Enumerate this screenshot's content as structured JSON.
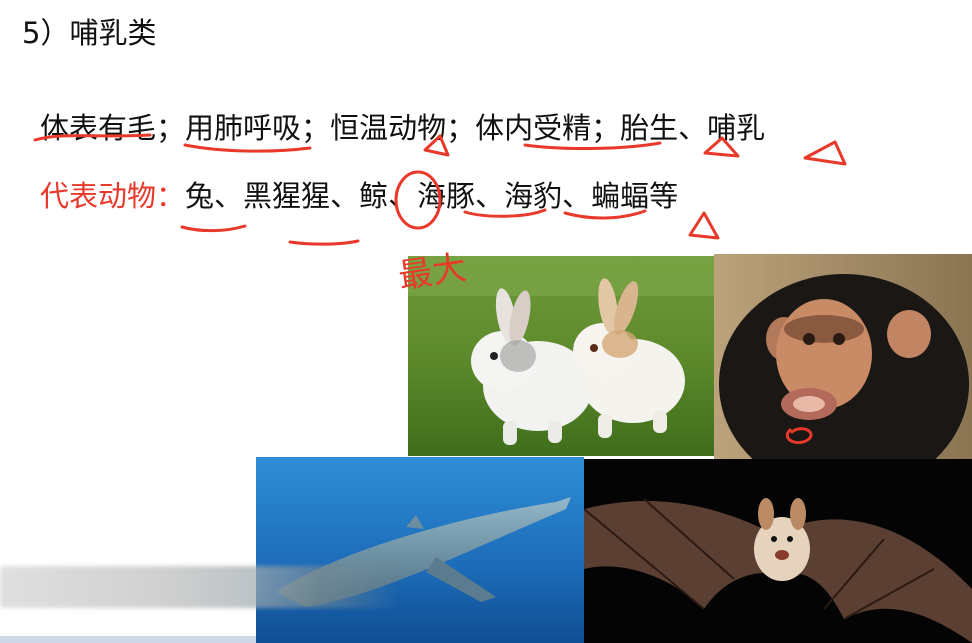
{
  "heading": "5）哺乳类",
  "traits": {
    "t1": "体表有毛",
    "s1": "；",
    "t2": "用肺呼吸",
    "s2": "；",
    "t3": "恒温动物",
    "s3": "；",
    "t4": "体内受精",
    "s4": "；",
    "t5": "胎生",
    "s5": "、",
    "t6": "哺乳"
  },
  "examples": {
    "label": "代表动物：",
    "a1": "兔",
    "s1": "、",
    "a2": "黑猩猩",
    "s2": "、",
    "a3": "鲸",
    "s3": "、",
    "a4": "海豚",
    "s4": "、",
    "a5": "海豹",
    "s5": "、",
    "a6": "蝙蝠等"
  },
  "annotation": {
    "handwritten_text": "最大",
    "ink_color": "#e8392b"
  },
  "photos": [
    "rabbits-photo",
    "chimpanzee-photo",
    "whale-photo",
    "bat-photo"
  ]
}
